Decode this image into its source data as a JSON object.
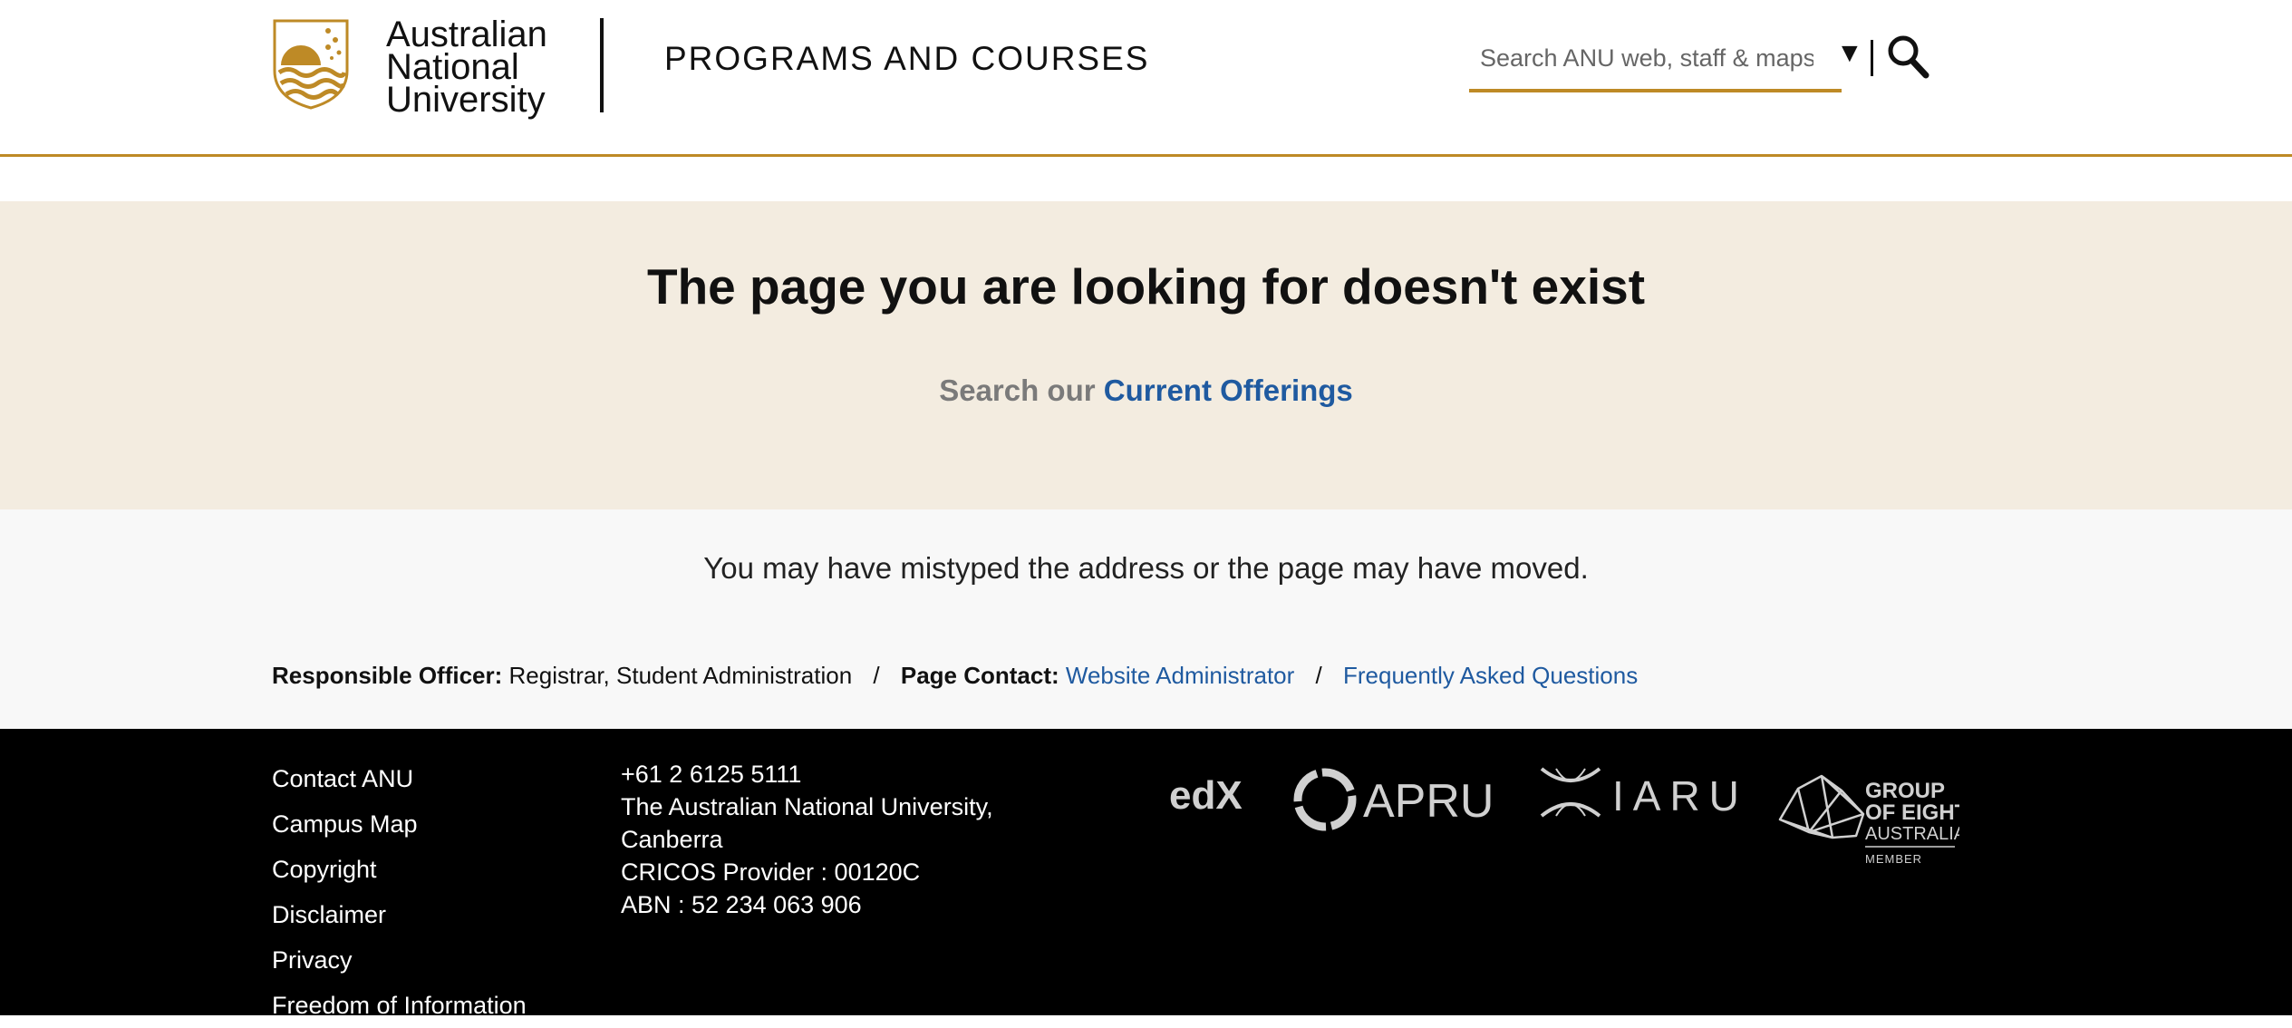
{
  "header": {
    "university_name": [
      "Australian",
      "National",
      "University"
    ],
    "site_title": "PROGRAMS AND COURSES",
    "search_placeholder": "Search ANU web, staff & maps",
    "dropdown_glyph": "▼",
    "search_icon": "search-icon",
    "accent_color": "#be8a26"
  },
  "hero": {
    "title": "The page you are looking for doesn't exist",
    "search_prefix": "Search our",
    "search_link": "Current Offerings"
  },
  "message": {
    "text": "You may have mistyped the address or the page may have moved."
  },
  "officer": {
    "responsible_label": "Responsible Officer:",
    "responsible_value": "Registrar, Student Administration",
    "separator": "/",
    "contact_label": "Page Contact:",
    "contact_link": "Website Administrator",
    "faq_link": "Frequently Asked Questions"
  },
  "footer": {
    "links": [
      "Contact ANU",
      "Campus Map",
      "Copyright",
      "Disclaimer",
      "Privacy",
      "Freedom of Information"
    ],
    "contact": {
      "phone": "+61 2 6125 5111",
      "address_line1": "The Australian National University,",
      "address_line2": "Canberra",
      "cricos": "CRICOS Provider : 00120C",
      "abn": "ABN : 52 234 063 906"
    },
    "partners": {
      "edx": "edX",
      "apru": "APRU",
      "iaru": "IARU",
      "go8_line1": "GROUP",
      "go8_line2": "OF EIGHT",
      "go8_line3": "AUSTRALIA",
      "go8_member": "MEMBER"
    }
  },
  "colors": {
    "gold": "#be8a26",
    "hero_bg": "#f3ece0",
    "link": "#1f5aa0",
    "footer_bg": "#000000"
  }
}
